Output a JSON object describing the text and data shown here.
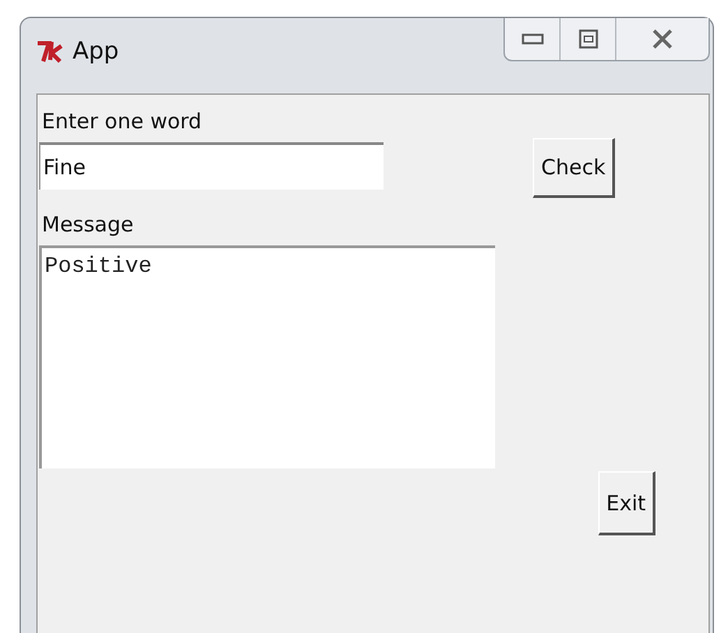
{
  "window": {
    "title": "App"
  },
  "word_label": "Enter one word",
  "word_field": {
    "value": "Fine"
  },
  "check_button": "Check",
  "message_label": "Message",
  "message_box": {
    "value": "Positive"
  },
  "exit_button": "Exit"
}
